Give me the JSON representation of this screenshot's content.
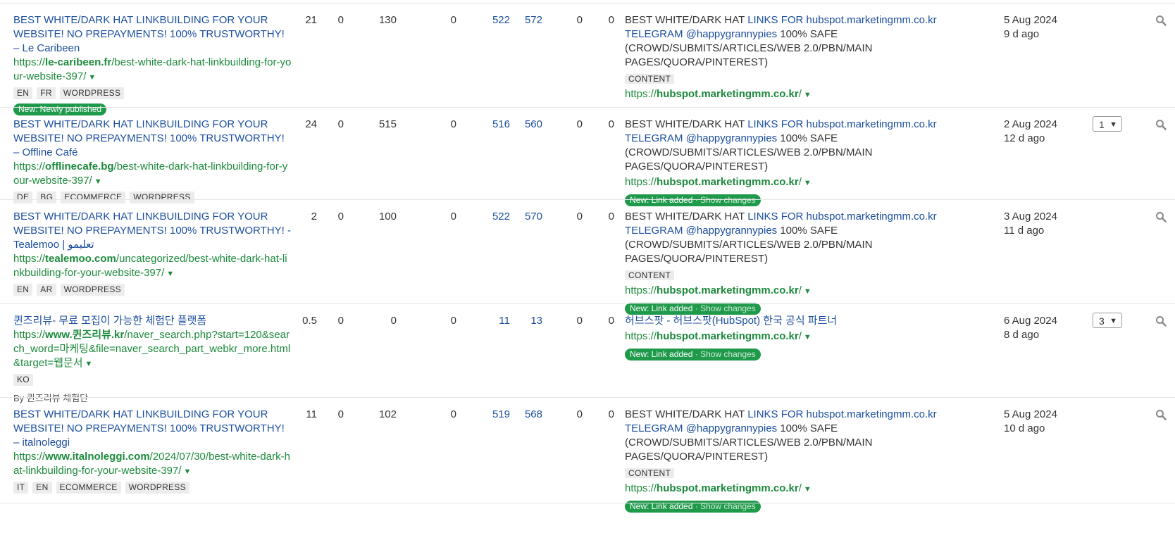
{
  "rows": [
    {
      "ref_title": "BEST WHITE/DARK HAT LINKBUILDING FOR YOUR WEBSITE! NO PREPAYMENTS! 100% TRUSTWORTHY! – Le Caribeen",
      "ref_url_pre": "https://",
      "ref_url_domain": "le-caribeen.fr",
      "ref_url_rest": "/best-white-dark-hat-linkbuilding-for-your-website-397/",
      "tags": [
        "EN",
        "FR",
        "WORDPRESS"
      ],
      "badge_label": "New: Newly published",
      "dr": "21",
      "ur": "0",
      "domains": "130",
      "ext": "0",
      "int1": "522",
      "int2": "572",
      "tr1": "0",
      "tr2": "0",
      "anchor_prefix": "BEST WHITE/DARK HAT ",
      "anchor_link": "LINKS FOR hubspot.marketingmm.co.kr TELEGRAM @happygrannypies",
      "anchor_suffix": " 100% SAFE (CROWD/SUBMITS/ARTICLES/WEB 2.0/PBN/MAIN PAGES/QUORA/PINTEREST)",
      "anchor_tag": "CONTENT",
      "target_pre": "https://",
      "target_domain": "hubspot.marketingmm.co.kr",
      "target_rest": "/",
      "date": "5 Aug 2024",
      "ago": "9 d ago"
    },
    {
      "ref_title": "BEST WHITE/DARK HAT LINKBUILDING FOR YOUR WEBSITE! NO PREPAYMENTS! 100% TRUSTWORTHY! – Offline Café",
      "ref_url_pre": "https://",
      "ref_url_domain": "offlinecafe.bg",
      "ref_url_rest": "/best-white-dark-hat-linkbuilding-for-your-website-397/",
      "tags": [
        "DE",
        "BG",
        "ECOMMERCE",
        "WORDPRESS"
      ],
      "dr": "24",
      "ur": "0",
      "domains": "515",
      "ext": "0",
      "int1": "516",
      "int2": "560",
      "tr1": "0",
      "tr2": "0",
      "anchor_prefix": "BEST WHITE/DARK HAT ",
      "anchor_link": "LINKS FOR hubspot.marketingmm.co.kr TELEGRAM @happygrannypies",
      "anchor_suffix": " 100% SAFE (CROWD/SUBMITS/ARTICLES/WEB 2.0/PBN/MAIN PAGES/QUORA/PINTEREST)",
      "target_pre": "https://",
      "target_domain": "hubspot.marketingmm.co.kr",
      "target_rest": "/",
      "anchor_badge": "New: Link added",
      "anchor_badge_action": "Show changes",
      "date": "2 Aug 2024",
      "ago": "12 d ago",
      "links_count": "1"
    },
    {
      "ref_title": "BEST WHITE/DARK HAT LINKBUILDING FOR YOUR WEBSITE! NO PREPAYMENTS! 100% TRUSTWORTHY! - Tealemoo | تعليمو",
      "ref_url_pre": "https://",
      "ref_url_domain": "tealemoo.com",
      "ref_url_rest": "/uncategorized/best-white-dark-hat-linkbuilding-for-your-website-397/",
      "tags": [
        "EN",
        "AR",
        "WORDPRESS"
      ],
      "dr": "2",
      "ur": "0",
      "domains": "100",
      "ext": "0",
      "int1": "522",
      "int2": "570",
      "tr1": "0",
      "tr2": "0",
      "anchor_prefix": "BEST WHITE/DARK HAT ",
      "anchor_link": "LINKS FOR hubspot.marketingmm.co.kr TELEGRAM @happygrannypies",
      "anchor_suffix": " 100% SAFE (CROWD/SUBMITS/ARTICLES/WEB 2.0/PBN/MAIN PAGES/QUORA/PINTEREST)",
      "anchor_tag": "CONTENT",
      "target_pre": "https://",
      "target_domain": "hubspot.marketingmm.co.kr",
      "target_rest": "/",
      "anchor_badge": "New: Link added",
      "anchor_badge_action": "Show changes",
      "date": "3 Aug 2024",
      "ago": "11 d ago"
    },
    {
      "ref_title": "퀸즈리뷰- 무료 모집이 가능한 체험단 플랫폼",
      "ref_url_pre": "https://",
      "ref_url_domain": "www.퀸즈리뷰.kr",
      "ref_url_rest": "/naver_search.php?start=120&search_word=마케팅&file=naver_search_part_webkr_more.html&target=웹문서",
      "tags": [
        "KO"
      ],
      "by_line": "By 퀸즈리뷰 체험단",
      "dr": "0.5",
      "ur": "0",
      "domains": "0",
      "ext": "0",
      "int1": "11",
      "int2": "13",
      "tr1": "0",
      "tr2": "0",
      "anchor_prefix": "",
      "anchor_link": "허브스팟 - 허브스팟(HubSpot) 한국 공식 파트너",
      "anchor_suffix": "",
      "target_pre": "https://",
      "target_domain": "hubspot.marketingmm.co.kr",
      "target_rest": "/",
      "anchor_badge": "New: Link added",
      "anchor_badge_action": "Show changes",
      "date": "6 Aug 2024",
      "ago": "8 d ago",
      "links_count": "3"
    },
    {
      "ref_title": "BEST WHITE/DARK HAT LINKBUILDING FOR YOUR WEBSITE! NO PREPAYMENTS! 100% TRUSTWORTHY! – italnoleggi",
      "ref_url_pre": "https://",
      "ref_url_domain": "www.italnoleggi.com",
      "ref_url_rest": "/2024/07/30/best-white-dark-hat-linkbuilding-for-your-website-397/",
      "tags": [
        "IT",
        "EN",
        "ECOMMERCE",
        "WORDPRESS"
      ],
      "dr": "11",
      "ur": "0",
      "domains": "102",
      "ext": "0",
      "int1": "519",
      "int2": "568",
      "tr1": "0",
      "tr2": "0",
      "anchor_prefix": "BEST WHITE/DARK HAT ",
      "anchor_link": "LINKS FOR hubspot.marketingmm.co.kr TELEGRAM @happygrannypies",
      "anchor_suffix": " 100% SAFE (CROWD/SUBMITS/ARTICLES/WEB 2.0/PBN/MAIN PAGES/QUORA/PINTEREST)",
      "anchor_tag": "CONTENT",
      "target_pre": "https://",
      "target_domain": "hubspot.marketingmm.co.kr",
      "target_rest": "/",
      "anchor_badge": "New: Link added",
      "anchor_badge_action": "Show changes",
      "date": "5 Aug 2024",
      "ago": "10 d ago"
    }
  ],
  "icons": {
    "search": "magnifier-icon",
    "caret": "caret-down-icon"
  },
  "colors": {
    "link": "#1a4e9e",
    "url": "#1c8a3c",
    "badge": "#1f9a4b"
  }
}
